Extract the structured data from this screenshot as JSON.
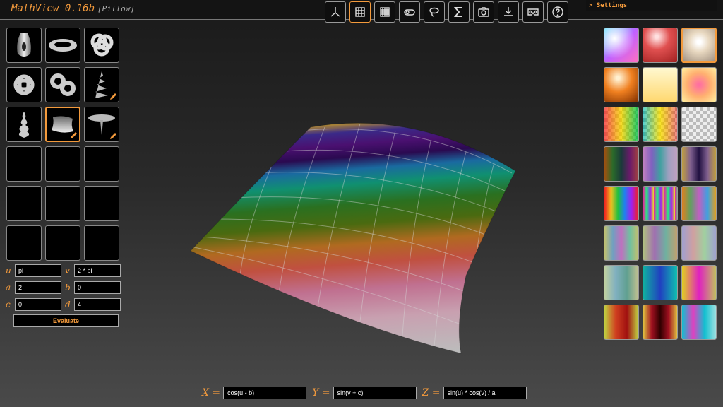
{
  "app": {
    "title": "MathView 0.16b",
    "subtitle": "[Pillow]"
  },
  "settings": {
    "label": "> Settings"
  },
  "toolbar": [
    {
      "name": "axes-icon"
    },
    {
      "name": "grid-icon",
      "active": true
    },
    {
      "name": "grid-dense-icon"
    },
    {
      "name": "toggle-icon"
    },
    {
      "name": "lasso-icon"
    },
    {
      "name": "sigma-icon"
    },
    {
      "name": "camera-icon"
    },
    {
      "name": "download-icon"
    },
    {
      "name": "vr-headset-icon"
    },
    {
      "name": "help-icon"
    }
  ],
  "params": {
    "u": {
      "label": "u",
      "value": "pi"
    },
    "v": {
      "label": "v",
      "value": "2 * pi"
    },
    "a": {
      "label": "a",
      "value": "2"
    },
    "b": {
      "label": "b",
      "value": "0"
    },
    "c": {
      "label": "c",
      "value": "0"
    },
    "d": {
      "label": "d",
      "value": "4"
    }
  },
  "evaluate_label": "Evaluate",
  "formulas": {
    "x": {
      "label": "X =",
      "value": "cos(u - b)"
    },
    "y": {
      "label": "Y =",
      "value": "sin(v + c)"
    },
    "z": {
      "label": "Z =",
      "value": "sin(u) * cos(v) / a"
    }
  },
  "colors": {
    "accent": "#f39a3c",
    "background": "#2a2a2a"
  }
}
